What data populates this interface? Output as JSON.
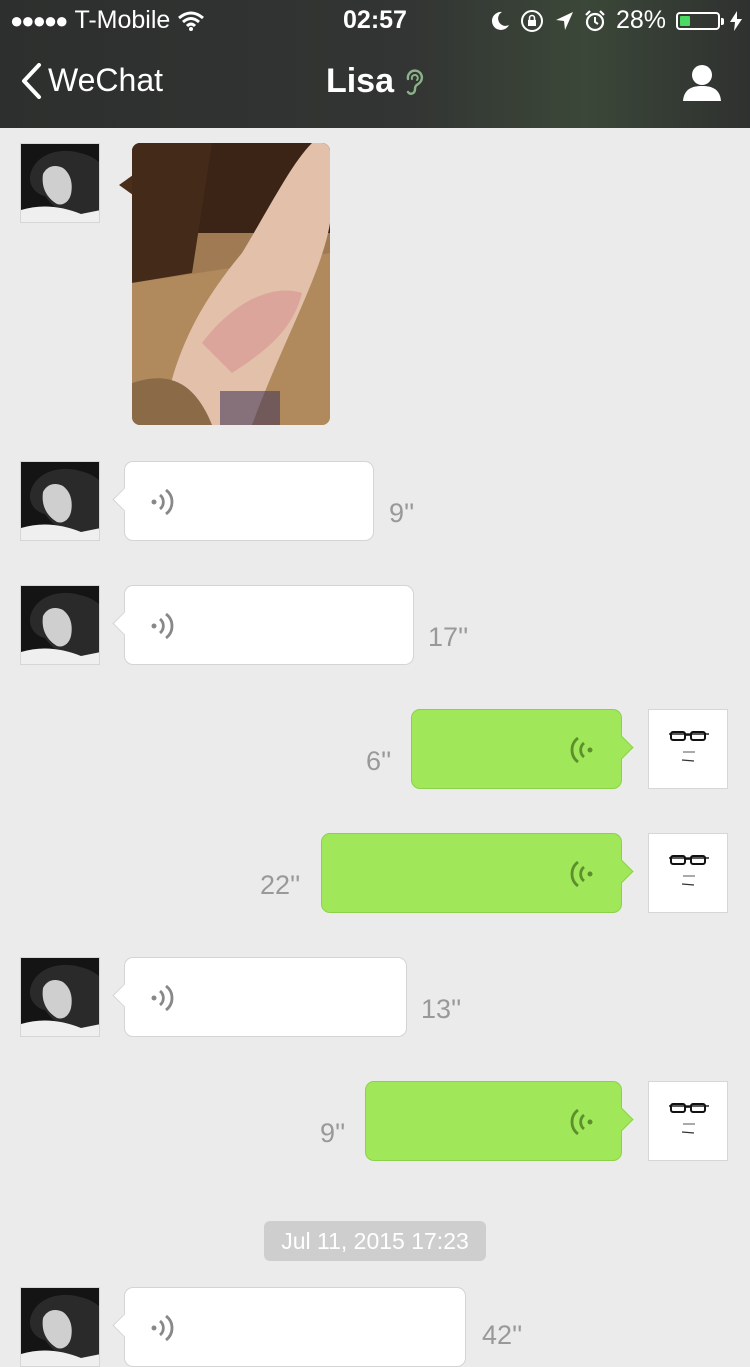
{
  "status_bar": {
    "carrier": "T-Mobile",
    "time": "02:57",
    "battery_percent": "28%",
    "battery_level": 0.28,
    "signal_bars": 5,
    "icons": [
      "wifi-icon",
      "moon-icon",
      "rotation-lock-icon",
      "location-arrow-icon",
      "alarm-icon",
      "battery-icon",
      "charging-bolt-icon"
    ]
  },
  "nav": {
    "back_label": "WeChat",
    "title": "Lisa",
    "title_icon": "ear-icon",
    "right_icon": "contact-profile-icon"
  },
  "colors": {
    "header_bg": "#2f3130",
    "chat_bg": "#ebebeb",
    "outgoing_bubble": "#a0e75a",
    "incoming_bubble": "#ffffff",
    "timestamp_bg": "#cecece"
  },
  "messages": [
    {
      "sender": "Lisa",
      "type": "image"
    },
    {
      "sender": "Lisa",
      "type": "voice",
      "duration": "9''"
    },
    {
      "sender": "Lisa",
      "type": "voice",
      "duration": "17''"
    },
    {
      "sender": "me",
      "type": "voice",
      "duration": "6''"
    },
    {
      "sender": "me",
      "type": "voice",
      "duration": "22''"
    },
    {
      "sender": "Lisa",
      "type": "voice",
      "duration": "13''"
    },
    {
      "sender": "me",
      "type": "voice",
      "duration": "9''"
    },
    {
      "type": "timestamp",
      "text": "Jul 11, 2015 17:23"
    },
    {
      "sender": "Lisa",
      "type": "voice",
      "duration": "42''"
    }
  ]
}
